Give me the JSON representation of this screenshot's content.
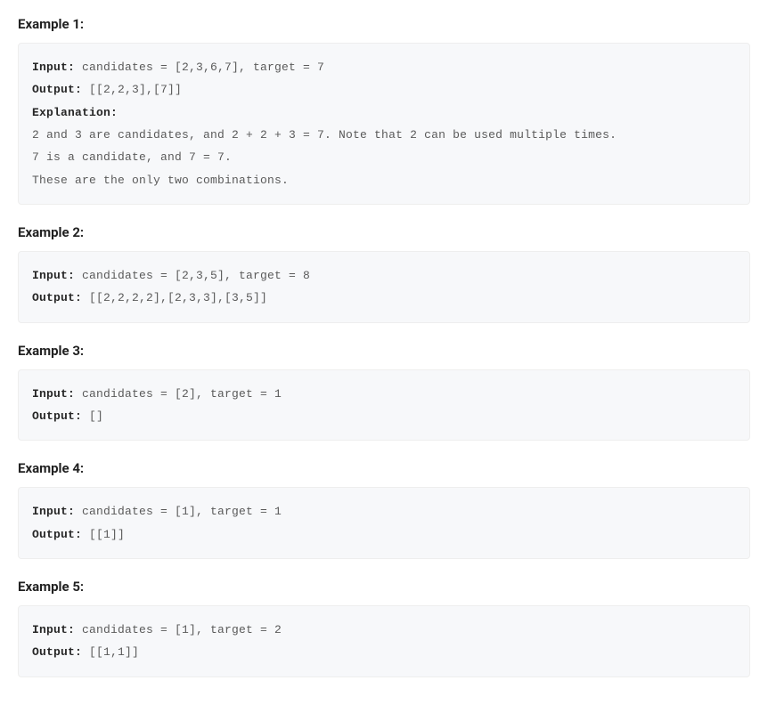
{
  "examples": [
    {
      "heading": "Example 1:",
      "lines": [
        {
          "label": "Input:",
          "text": " candidates = [2,3,6,7], target = 7"
        },
        {
          "label": "Output:",
          "text": " [[2,2,3],[7]]"
        },
        {
          "label": "Explanation:",
          "text": ""
        },
        {
          "label": "",
          "text": "2 and 3 are candidates, and 2 + 2 + 3 = 7. Note that 2 can be used multiple times."
        },
        {
          "label": "",
          "text": "7 is a candidate, and 7 = 7."
        },
        {
          "label": "",
          "text": "These are the only two combinations."
        }
      ]
    },
    {
      "heading": "Example 2:",
      "lines": [
        {
          "label": "Input:",
          "text": " candidates = [2,3,5], target = 8"
        },
        {
          "label": "Output:",
          "text": " [[2,2,2,2],[2,3,3],[3,5]]"
        }
      ]
    },
    {
      "heading": "Example 3:",
      "lines": [
        {
          "label": "Input:",
          "text": " candidates = [2], target = 1"
        },
        {
          "label": "Output:",
          "text": " []"
        }
      ]
    },
    {
      "heading": "Example 4:",
      "lines": [
        {
          "label": "Input:",
          "text": " candidates = [1], target = 1"
        },
        {
          "label": "Output:",
          "text": " [[1]]"
        }
      ]
    },
    {
      "heading": "Example 5:",
      "lines": [
        {
          "label": "Input:",
          "text": " candidates = [1], target = 2"
        },
        {
          "label": "Output:",
          "text": " [[1,1]]"
        }
      ]
    }
  ]
}
